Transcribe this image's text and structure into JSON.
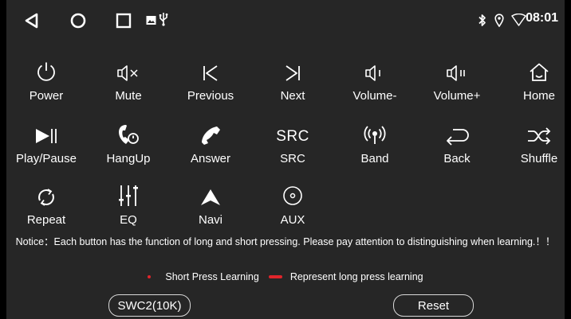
{
  "status_bar": {
    "time": "08:01",
    "icons": [
      "back-triangle-icon",
      "home-circle-icon",
      "recents-square-icon",
      "gallery-icon",
      "usb-icon",
      "bluetooth-icon",
      "location-icon",
      "wifi-icon"
    ]
  },
  "keys": [
    {
      "label": "Power",
      "icon": "power-icon"
    },
    {
      "label": "Mute",
      "icon": "mute-icon"
    },
    {
      "label": "Previous",
      "icon": "previous-icon"
    },
    {
      "label": "Next",
      "icon": "next-icon"
    },
    {
      "label": "Volume-",
      "icon": "volume-down-icon"
    },
    {
      "label": "Volume+",
      "icon": "volume-up-icon"
    },
    {
      "label": "Home",
      "icon": "home-icon"
    },
    {
      "label": "Play/Pause",
      "icon": "play-pause-icon"
    },
    {
      "label": "HangUp",
      "icon": "hangup-icon"
    },
    {
      "label": "Answer",
      "icon": "answer-icon"
    },
    {
      "label": "SRC",
      "icon_text": "SRC"
    },
    {
      "label": "Band",
      "icon": "band-icon"
    },
    {
      "label": "Back",
      "icon": "back-arrow-icon"
    },
    {
      "label": "Shuffle",
      "icon": "shuffle-icon"
    },
    {
      "label": "Repeat",
      "icon": "repeat-icon"
    },
    {
      "label": "EQ",
      "icon": "eq-icon"
    },
    {
      "label": "Navi",
      "icon": "navi-icon"
    },
    {
      "label": "AUX",
      "icon": "aux-icon"
    }
  ],
  "notice": "Notice：Each button has the function of long and short pressing. Please pay attention to distinguishing when learning.！！",
  "legend": {
    "short": "Short Press Learning",
    "long": "Represent long press learning",
    "color": "#e0252b"
  },
  "buttons": {
    "mode": "SWC2(10K)",
    "reset": "Reset"
  }
}
